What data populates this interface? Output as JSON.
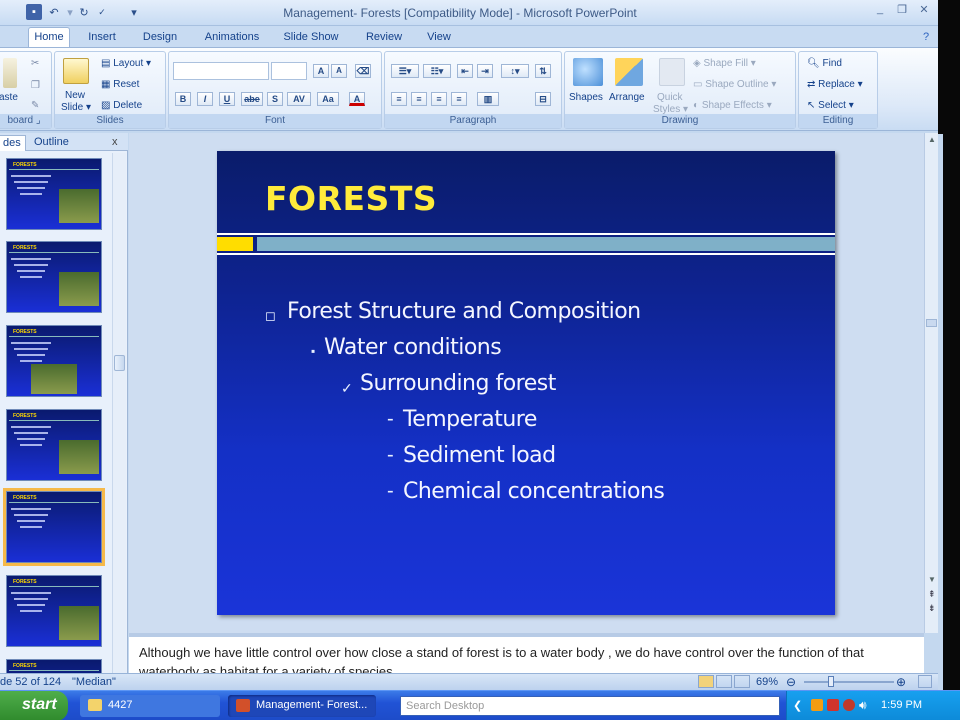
{
  "window": {
    "title": "Management- Forests [Compatibility Mode] - Microsoft PowerPoint",
    "minimize": "_",
    "restore": "❐",
    "close": "✕"
  },
  "ribbon_tabs": [
    "Home",
    "Insert",
    "Design",
    "Animations",
    "Slide Show",
    "Review",
    "View"
  ],
  "ribbon": {
    "clipboard": {
      "label": "board",
      "paste": "aste"
    },
    "slides": {
      "label": "Slides",
      "new_slide_1": "New",
      "new_slide_2": "Slide",
      "layout": "Layout",
      "reset": "Reset",
      "delete": "Delete"
    },
    "font": {
      "label": "Font",
      "grow": "A",
      "shrink": "A",
      "bold": "B",
      "italic": "I",
      "underline": "U",
      "strike": "abe",
      "shadow": "S",
      "spacing": "AV",
      "case": "Aa",
      "color": "A"
    },
    "paragraph": {
      "label": "Paragraph"
    },
    "drawing": {
      "label": "Drawing",
      "shapes": "Shapes",
      "arrange": "Arrange",
      "quick_styles_1": "Quick",
      "quick_styles_2": "Styles",
      "shape_fill": "Shape Fill",
      "shape_outline": "Shape Outline",
      "shape_effects": "Shape Effects"
    },
    "editing": {
      "label": "Editing",
      "find": "Find",
      "replace": "Replace",
      "select": "Select"
    }
  },
  "left_pane": {
    "tab_slides": "des",
    "tab_outline": "Outline",
    "close": "x"
  },
  "thumbnails": [
    {
      "title": "FORESTS"
    },
    {
      "title": "FORESTS"
    },
    {
      "title": "FORESTS"
    },
    {
      "title": "FORESTS"
    },
    {
      "title": "FORESTS"
    },
    {
      "title": "FORESTS"
    },
    {
      "title": "FORESTS"
    }
  ],
  "slide": {
    "title": "FORESTS",
    "bullets": [
      {
        "marker": "◻",
        "text": "Forest Structure and Composition"
      },
      {
        "marker": "▪",
        "text": "Water conditions"
      },
      {
        "marker": "✓",
        "text": "Surrounding forest"
      },
      {
        "marker": "-",
        "text": "Temperature"
      },
      {
        "marker": "-",
        "text": "Sediment load"
      },
      {
        "marker": "-",
        "text": "Chemical concentrations"
      }
    ]
  },
  "notes": "Although we have little control over how close a stand of forest is to a water body , we do have control over the function of that waterbody as habitat for a variety of species.",
  "status": {
    "slide_info": "de 52 of 124",
    "theme": "\"Median\"",
    "zoom": "69%"
  },
  "taskbar": {
    "start": "start",
    "folder": "4427",
    "powerpoint": "Management- Forest...",
    "search_placeholder": "Search Desktop",
    "clock": "1:59 PM"
  },
  "colors": {
    "slide_title": "#ffeb3b",
    "slide_bg_top": "#0a1c6a",
    "slide_bg_bottom": "#1a34d8",
    "band_yellow": "#ffdd00",
    "band_teal": "#7fb0c8"
  }
}
